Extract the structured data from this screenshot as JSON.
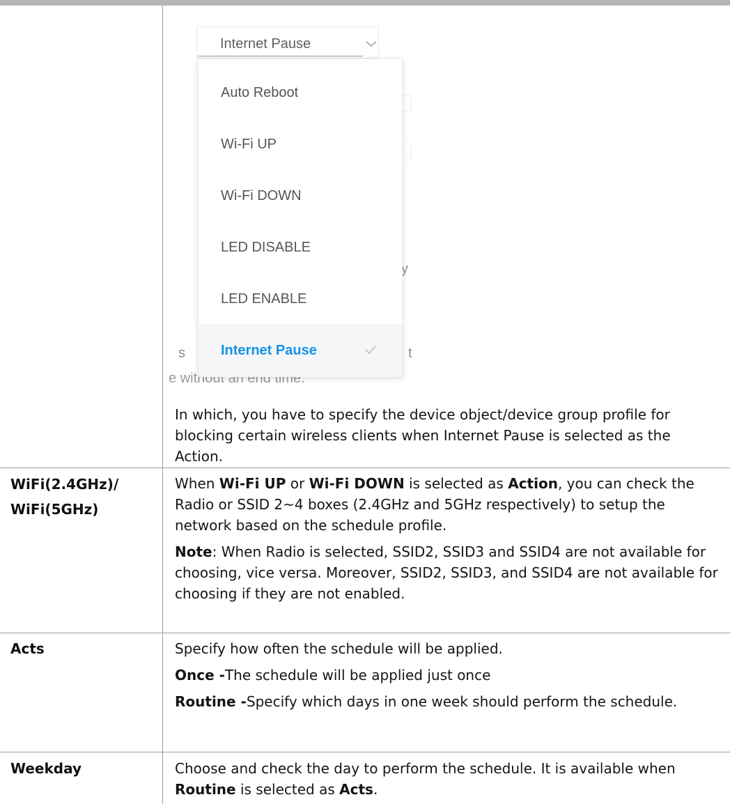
{
  "dropdown": {
    "current_value": "Internet Pause",
    "options": [
      "Auto Reboot",
      "Wi-Fi UP",
      "Wi-Fi DOWN",
      "LED DISABLE",
      "LED ENABLE",
      "Internet Pause"
    ],
    "selected_index": 5,
    "accent_color": "#1593e6"
  },
  "background_fragments": {
    "left_fragment": "s",
    "right_fragment": "t",
    "right_y": "y",
    "bottom_line": "e without an end time."
  },
  "intro_text": "In which, you have to specify the device object/device group profile for blocking certain wireless clients when Internet Pause is selected as the Action.",
  "rows": [
    {
      "label_line1": "WiFi(2.4GHz)/",
      "label_line2": "WiFi(5GHz)",
      "p1_a": "When ",
      "p1_b": "Wi-Fi UP",
      "p1_c": " or ",
      "p1_d": "Wi-Fi DOWN",
      "p1_e": " is selected as ",
      "p1_f": "Action",
      "p1_g": ", you can check the Radio or SSID 2~4 boxes (2.4GHz and 5GHz respectively) to setup the network based on the schedule profile.",
      "note_label": "Note",
      "note_text": ": When Radio is selected, SSID2, SSID3 and SSID4 are not available for choosing, vice versa. Moreover, SSID2, SSID3, and SSID4 are not available for choosing if they are not enabled."
    },
    {
      "label": "Acts",
      "p1": "Specify how often the schedule will be applied.",
      "once_label": "Once -",
      "once_text": "The schedule will be applied just once",
      "routine_label": "Routine -",
      "routine_text": "Specify which days in one week should perform the schedule."
    },
    {
      "label": "Weekday",
      "p1_a": "Choose and check the day to perform the schedule. It is available when ",
      "p1_b": "Routine",
      "p1_c": " is selected as ",
      "p1_d": "Acts",
      "p1_e": "."
    }
  ]
}
